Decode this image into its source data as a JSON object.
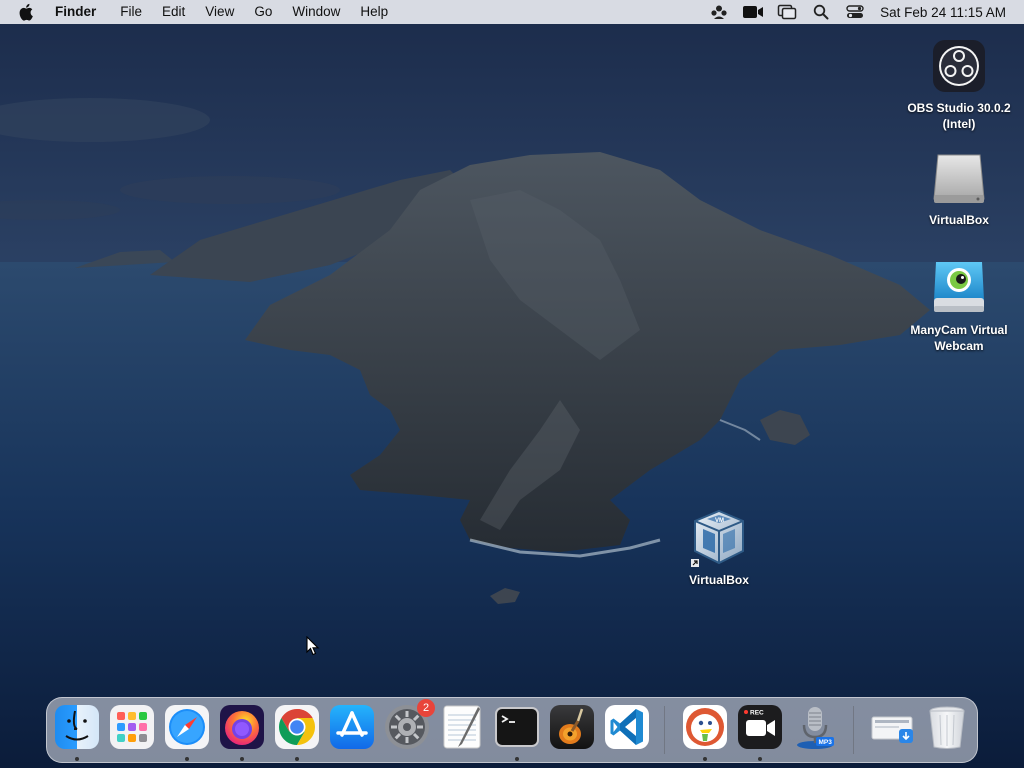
{
  "menubar": {
    "app_name": "Finder",
    "menus": [
      "File",
      "Edit",
      "View",
      "Go",
      "Window",
      "Help"
    ],
    "clock": "Sat Feb 24  11:15 AM",
    "status_icons": [
      "user-group-icon",
      "video-camera-icon",
      "screen-mirroring-icon",
      "spotlight-search-icon",
      "control-center-icon"
    ]
  },
  "desktop": {
    "icons": [
      {
        "label": "OBS Studio 30.0.2 (Intel)",
        "icon": "obs-studio-icon"
      },
      {
        "label": "VirtualBox",
        "icon": "disk-image-icon"
      },
      {
        "label": "ManyCam Virtual Webcam",
        "icon": "manycam-installer-icon"
      },
      {
        "label": "VirtualBox",
        "icon": "virtualbox-alias-icon"
      }
    ]
  },
  "dock": {
    "apps": [
      {
        "name": "Finder",
        "icon": "finder-icon",
        "running": true
      },
      {
        "name": "Launchpad",
        "icon": "launchpad-icon",
        "running": false
      },
      {
        "name": "Safari",
        "icon": "safari-icon",
        "running": true
      },
      {
        "name": "Firefox",
        "icon": "firefox-icon",
        "running": true
      },
      {
        "name": "Google Chrome",
        "icon": "chrome-icon",
        "running": true
      },
      {
        "name": "App Store",
        "icon": "app-store-icon",
        "running": false
      },
      {
        "name": "System Preferences",
        "icon": "system-preferences-icon",
        "running": false,
        "badge": "2"
      },
      {
        "name": "TextEdit",
        "icon": "textedit-icon",
        "running": false
      },
      {
        "name": "Terminal",
        "icon": "terminal-icon",
        "running": true
      },
      {
        "name": "GarageBand",
        "icon": "garageband-icon",
        "running": false
      },
      {
        "name": "Visual Studio Code",
        "icon": "vscode-icon",
        "running": false
      },
      {
        "name": "DuckDuckGo",
        "icon": "duckduckgo-icon",
        "running": true
      },
      {
        "name": "Screen Recorder",
        "icon": "screen-recorder-icon",
        "running": true,
        "tag": "REC"
      },
      {
        "name": "Audio Recorder",
        "icon": "microphone-mp3-icon",
        "running": false,
        "tag": "MP3"
      },
      {
        "name": "Downloads",
        "icon": "downloads-stack-icon",
        "running": false
      },
      {
        "name": "Trash",
        "icon": "trash-icon",
        "running": false
      }
    ]
  },
  "colors": {
    "menubar_bg": "#e8eaf0",
    "badge": "#e8443a",
    "vscode_blue": "#1f8ad2",
    "chrome_red": "#db4437",
    "chrome_yellow": "#f4c20d",
    "chrome_green": "#0f9d58"
  }
}
